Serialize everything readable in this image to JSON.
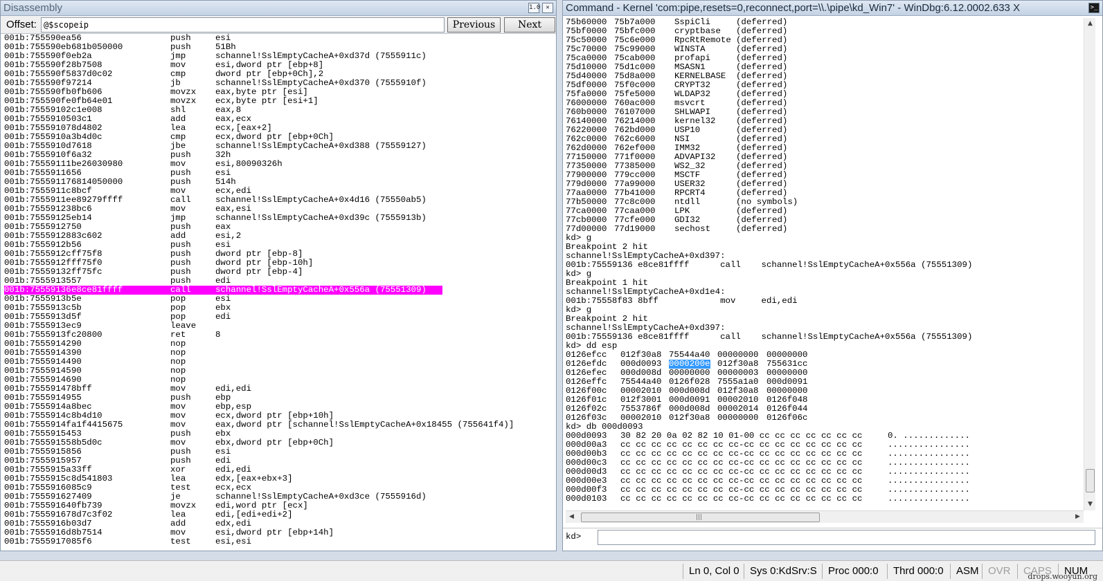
{
  "disassembly": {
    "title": "Disassembly",
    "offset_label": "Offset:",
    "offset_value": "@$scopeip",
    "previous_label": "Previous",
    "next_label": "Next",
    "restore_icon": "restore-icon",
    "close_icon": "close-icon",
    "highlight_color": "#ff00ff",
    "rows": [
      [
        "001b:755590ea",
        "56",
        "push",
        "esi"
      ],
      [
        "001b:755590eb",
        "681b050000",
        "push",
        "51Bh"
      ],
      [
        "001b:755590f0",
        "eb2a",
        "jmp",
        "schannel!SslEmptyCacheA+0xd37d (7555911c)"
      ],
      [
        "001b:755590f2",
        "8b7508",
        "mov",
        "esi,dword ptr [ebp+8]"
      ],
      [
        "001b:755590f5",
        "837d0c02",
        "cmp",
        "dword ptr [ebp+0Ch],2"
      ],
      [
        "001b:755590f9",
        "7214",
        "jb",
        "schannel!SslEmptyCacheA+0xd370 (7555910f)"
      ],
      [
        "001b:755590fb",
        "0fb606",
        "movzx",
        "eax,byte ptr [esi]"
      ],
      [
        "001b:755590fe",
        "0fb64e01",
        "movzx",
        "ecx,byte ptr [esi+1]"
      ],
      [
        "001b:75559102",
        "c1e008",
        "shl",
        "eax,8"
      ],
      [
        "001b:75559105",
        "03c1",
        "add",
        "eax,ecx"
      ],
      [
        "001b:75559107",
        "8d4802",
        "lea",
        "ecx,[eax+2]"
      ],
      [
        "001b:7555910a",
        "3b4d0c",
        "cmp",
        "ecx,dword ptr [ebp+0Ch]"
      ],
      [
        "001b:7555910d",
        "7618",
        "jbe",
        "schannel!SslEmptyCacheA+0xd388 (75559127)"
      ],
      [
        "001b:7555910f",
        "6a32",
        "push",
        "32h"
      ],
      [
        "001b:75559111",
        "be26030980",
        "mov",
        "esi,80090326h"
      ],
      [
        "001b:75559116",
        "56",
        "push",
        "esi"
      ],
      [
        "001b:75559117",
        "6814050000",
        "push",
        "514h"
      ],
      [
        "001b:7555911c",
        "8bcf",
        "mov",
        "ecx,edi"
      ],
      [
        "001b:7555911e",
        "e89279ffff",
        "call",
        "schannel!SslEmptyCacheA+0x4d16 (75550ab5)"
      ],
      [
        "001b:75559123",
        "8bc6",
        "mov",
        "eax,esi"
      ],
      [
        "001b:75559125",
        "eb14",
        "jmp",
        "schannel!SslEmptyCacheA+0xd39c (7555913b)"
      ],
      [
        "001b:75559127",
        "50",
        "push",
        "eax"
      ],
      [
        "001b:75559128",
        "83c602",
        "add",
        "esi,2"
      ],
      [
        "001b:7555912b",
        "56",
        "push",
        "esi"
      ],
      [
        "001b:7555912c",
        "ff75f8",
        "push",
        "dword ptr [ebp-8]"
      ],
      [
        "001b:7555912f",
        "ff75f0",
        "push",
        "dword ptr [ebp-10h]"
      ],
      [
        "001b:75559132",
        "ff75fc",
        "push",
        "dword ptr [ebp-4]"
      ],
      [
        "001b:75559135",
        "57",
        "push",
        "edi"
      ],
      [
        "001b:75559136",
        "e8ce81ffff",
        "call",
        "schannel!SslEmptyCacheA+0x556a (75551309)"
      ],
      [
        "001b:7555913b",
        "5e",
        "pop",
        "esi"
      ],
      [
        "001b:7555913c",
        "5b",
        "pop",
        "ebx"
      ],
      [
        "001b:7555913d",
        "5f",
        "pop",
        "edi"
      ],
      [
        "001b:7555913e",
        "c9",
        "leave",
        ""
      ],
      [
        "001b:7555913f",
        "c20800",
        "ret",
        "8"
      ],
      [
        "001b:75559142",
        "90",
        "nop",
        ""
      ],
      [
        "001b:75559143",
        "90",
        "nop",
        ""
      ],
      [
        "001b:75559144",
        "90",
        "nop",
        ""
      ],
      [
        "001b:75559145",
        "90",
        "nop",
        ""
      ],
      [
        "001b:75559146",
        "90",
        "nop",
        ""
      ],
      [
        "001b:75559147",
        "8bff",
        "mov",
        "edi,edi"
      ],
      [
        "001b:75559149",
        "55",
        "push",
        "ebp"
      ],
      [
        "001b:7555914a",
        "8bec",
        "mov",
        "ebp,esp"
      ],
      [
        "001b:7555914c",
        "8b4d10",
        "mov",
        "ecx,dword ptr [ebp+10h]"
      ],
      [
        "001b:7555914f",
        "a1f4415675",
        "mov",
        "eax,dword ptr [schannel!SslEmptyCacheA+0x18455 (755641f4)]"
      ],
      [
        "001b:75559154",
        "53",
        "push",
        "ebx"
      ],
      [
        "001b:75559155",
        "8b5d0c",
        "mov",
        "ebx,dword ptr [ebp+0Ch]"
      ],
      [
        "001b:75559158",
        "56",
        "push",
        "esi"
      ],
      [
        "001b:75559159",
        "57",
        "push",
        "edi"
      ],
      [
        "001b:7555915a",
        "33ff",
        "xor",
        "edi,edi"
      ],
      [
        "001b:7555915c",
        "8d541803",
        "lea",
        "edx,[eax+ebx+3]"
      ],
      [
        "001b:75559160",
        "85c9",
        "test",
        "ecx,ecx"
      ],
      [
        "001b:75559162",
        "7409",
        "je",
        "schannel!SslEmptyCacheA+0xd3ce (7555916d)"
      ],
      [
        "001b:75559164",
        "0fb739",
        "movzx",
        "edi,word ptr [ecx]"
      ],
      [
        "001b:75559167",
        "8d7c3f02",
        "lea",
        "edi,[edi+edi+2]"
      ],
      [
        "001b:7555916b",
        "03d7",
        "add",
        "edx,edi"
      ],
      [
        "001b:7555916d",
        "8b7514",
        "mov",
        "esi,dword ptr [ebp+14h]"
      ],
      [
        "001b:75559170",
        "85f6",
        "test",
        "esi,esi"
      ]
    ],
    "highlighted_index": 28
  },
  "command": {
    "title": "Command - Kernel 'com:pipe,resets=0,reconnect,port=\\\\.\\pipe\\kd_Win7' - WinDbg:6.12.0002.633 X",
    "prompt": "kd>",
    "input_value": "",
    "dock_icon": "dock-icon",
    "selection_color": "#3399ff",
    "modules": [
      [
        "75b60000",
        "75b7a000",
        "SspiCli",
        "(deferred)"
      ],
      [
        "75bf0000",
        "75bfc000",
        "cryptbase",
        "(deferred)"
      ],
      [
        "75c50000",
        "75c6e000",
        "RpcRtRemote",
        "(deferred)"
      ],
      [
        "75c70000",
        "75c99000",
        "WINSTA",
        "(deferred)"
      ],
      [
        "75ca0000",
        "75cab000",
        "profapi",
        "(deferred)"
      ],
      [
        "75d10000",
        "75d1c000",
        "MSASN1",
        "(deferred)"
      ],
      [
        "75d40000",
        "75d8a000",
        "KERNELBASE",
        "(deferred)"
      ],
      [
        "75df0000",
        "75f0c000",
        "CRYPT32",
        "(deferred)"
      ],
      [
        "75fa0000",
        "75fe5000",
        "WLDAP32",
        "(deferred)"
      ],
      [
        "76000000",
        "760ac000",
        "msvcrt",
        "(deferred)"
      ],
      [
        "760b0000",
        "76107000",
        "SHLWAPI",
        "(deferred)"
      ],
      [
        "76140000",
        "76214000",
        "kernel32",
        "(deferred)"
      ],
      [
        "76220000",
        "762bd000",
        "USP10",
        "(deferred)"
      ],
      [
        "762c0000",
        "762c6000",
        "NSI",
        "(deferred)"
      ],
      [
        "762d0000",
        "762ef000",
        "IMM32",
        "(deferred)"
      ],
      [
        "77150000",
        "771f0000",
        "ADVAPI32",
        "(deferred)"
      ],
      [
        "77350000",
        "77385000",
        "WS2_32",
        "(deferred)"
      ],
      [
        "77900000",
        "779cc000",
        "MSCTF",
        "(deferred)"
      ],
      [
        "779d0000",
        "77a99000",
        "USER32",
        "(deferred)"
      ],
      [
        "77aa0000",
        "77b41000",
        "RPCRT4",
        "(deferred)"
      ],
      [
        "77b50000",
        "77c8c000",
        "ntdll",
        "(no symbols)"
      ],
      [
        "77ca0000",
        "77caa000",
        "LPK",
        "(deferred)"
      ],
      [
        "77cb0000",
        "77cfe000",
        "GDI32",
        "(deferred)"
      ],
      [
        "77d00000",
        "77d19000",
        "sechost",
        "(deferred)"
      ]
    ],
    "session": [
      "kd> g",
      "Breakpoint 2 hit",
      "schannel!SslEmptyCacheA+0xd397:",
      "001b:75559136 e8ce81ffff      call    schannel!SslEmptyCacheA+0x556a (75551309)",
      "kd> g",
      "Breakpoint 1 hit",
      "schannel!SslEmptyCacheA+0xd1e4:",
      "001b:75558f83 8bff            mov     edi,edi",
      "kd> g",
      "Breakpoint 2 hit",
      "schannel!SslEmptyCacheA+0xd397:",
      "001b:75559136 e8ce81ffff      call    schannel!SslEmptyCacheA+0x556a (75551309)",
      "kd> dd esp"
    ],
    "dd_rows": [
      [
        "0126efcc",
        "012f30a8",
        "75544a40",
        "00000000",
        "00000000"
      ],
      [
        "0126efdc",
        "000d0093",
        "0000200e",
        "012f30a8",
        "755631cc"
      ],
      [
        "0126efec",
        "000d008d",
        "00000000",
        "00000003",
        "00000000"
      ],
      [
        "0126effc",
        "75544a40",
        "0126f028",
        "7555a1a0",
        "000d0091"
      ],
      [
        "0126f00c",
        "00002010",
        "000d008d",
        "012f30a8",
        "00000000"
      ],
      [
        "0126f01c",
        "012f3001",
        "000d0091",
        "00002010",
        "0126f048"
      ],
      [
        "0126f02c",
        "7553786f",
        "000d008d",
        "00002014",
        "0126f044"
      ],
      [
        "0126f03c",
        "00002010",
        "012f30a8",
        "00000000",
        "0126f06c"
      ]
    ],
    "db_cmd": "kd> db 000d0093",
    "db_rows": [
      [
        "000d0093",
        "30 82 20 0a 02 82 10 01-00 cc cc cc cc cc cc cc",
        "0. ............."
      ],
      [
        "000d00a3",
        "cc cc cc cc cc cc cc cc-cc cc cc cc cc cc cc cc",
        "................"
      ],
      [
        "000d00b3",
        "cc cc cc cc cc cc cc cc-cc cc cc cc cc cc cc cc",
        "................"
      ],
      [
        "000d00c3",
        "cc cc cc cc cc cc cc cc-cc cc cc cc cc cc cc cc",
        "................"
      ],
      [
        "000d00d3",
        "cc cc cc cc cc cc cc cc-cc cc cc cc cc cc cc cc",
        "................"
      ],
      [
        "000d00e3",
        "cc cc cc cc cc cc cc cc-cc cc cc cc cc cc cc cc",
        "................"
      ],
      [
        "000d00f3",
        "cc cc cc cc cc cc cc cc-cc cc cc cc cc cc cc cc",
        "................"
      ],
      [
        "000d0103",
        "cc cc cc cc cc cc cc cc-cc cc cc cc cc cc cc cc",
        "................"
      ]
    ],
    "selected_dd_cell": [
      1,
      2
    ]
  },
  "status": {
    "ln_col": "Ln 0, Col 0",
    "sys": "Sys 0:KdSrv:S",
    "proc": "Proc 000:0",
    "thrd": "Thrd 000:0",
    "asm": "ASM",
    "ovr": "OVR",
    "caps": "CAPS",
    "num": "NUM",
    "watermark": "drops.wooyun.org"
  }
}
